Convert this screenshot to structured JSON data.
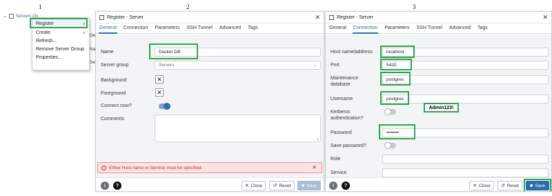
{
  "step_numbers": [
    "1",
    "2",
    "3"
  ],
  "panel1": {
    "tree_label": "Servers (3)",
    "menu": [
      {
        "label": "Register",
        "has_submenu": true
      },
      {
        "label": "Create",
        "has_submenu": true
      },
      {
        "label": "Refresh...",
        "has_submenu": false
      },
      {
        "label": "Remove Server Group",
        "has_submenu": false
      },
      {
        "label": "Properties...",
        "has_submenu": false
      }
    ],
    "peek": [
      "Ge",
      "Na",
      "Se"
    ]
  },
  "dialog2": {
    "title": "Register - Server",
    "tabs": [
      "General",
      "Connection",
      "Parameters",
      "SSH Tunnel",
      "Advanced",
      "Tags"
    ],
    "active_tab": "General",
    "fields": {
      "name_label": "Name",
      "name_value": "Docker DB",
      "server_group_label": "Server group",
      "server_group_value": "Servers",
      "background_label": "Background",
      "foreground_label": "Foreground",
      "connect_now_label": "Connect now?",
      "connect_now": true,
      "comments_label": "Comments"
    },
    "error": "Either Host name or Service must be specified.",
    "buttons": {
      "close": "Close",
      "reset": "Reset",
      "save": "Save"
    },
    "save_enabled": false
  },
  "dialog3": {
    "title": "Register - Server",
    "tabs": [
      "General",
      "Connection",
      "Parameters",
      "SSH Tunnel",
      "Advanced",
      "Tags"
    ],
    "active_tab": "Connection",
    "fields": {
      "host_label": "Host name/address",
      "host_value": "localhost",
      "port_label": "Port",
      "port_value": "5432",
      "maint_db_label_1": "Maintenance",
      "maint_db_label_2": "database",
      "maint_db_value": "postgres",
      "username_label": "Username",
      "username_value": "postgres",
      "kerberos_label_1": "Kerberos",
      "kerberos_label_2": "authentication?",
      "kerberos": false,
      "password_label": "Password",
      "password_value": "••••••••",
      "save_password_label": "Save password?",
      "save_password": false,
      "role_label": "Role",
      "service_label": "Service"
    },
    "password_note": "Admin123!",
    "buttons": {
      "close": "Close",
      "reset": "Reset",
      "save": "Save"
    },
    "save_enabled": true
  },
  "colors": {
    "highlight": "#2ea44f",
    "accent": "#2a6db0",
    "error": "#c0292f"
  }
}
